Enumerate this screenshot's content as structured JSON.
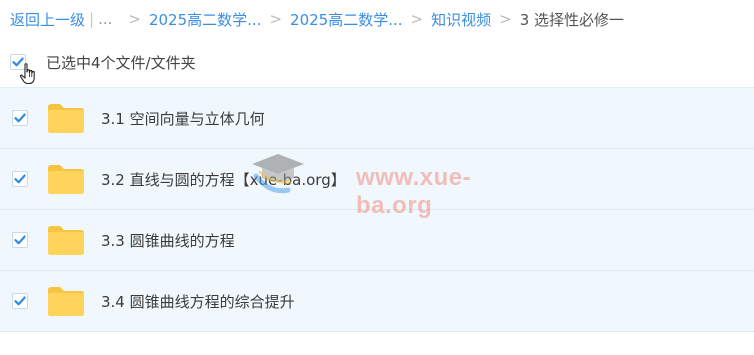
{
  "breadcrumb": {
    "back": "返回上一级",
    "divider": "|",
    "ellipsis": "...",
    "items": [
      "2025高二数学...",
      "2025高二数学...",
      "知识视频"
    ],
    "separator": ">",
    "current": "3 选择性必修一"
  },
  "selection": {
    "label": "已选中4个文件/文件夹",
    "checked": true
  },
  "files": [
    {
      "name": "3.1 空间向量与立体几何",
      "checked": true,
      "icon": "folder-icon"
    },
    {
      "name": "3.2 直线与圆的方程【xue-ba.org】",
      "checked": true,
      "icon": "folder-icon"
    },
    {
      "name": "3.3 圆锥曲线的方程",
      "checked": true,
      "icon": "folder-icon"
    },
    {
      "name": "3.4 圆锥曲线方程的综合提升",
      "checked": true,
      "icon": "folder-icon"
    }
  ],
  "watermark": {
    "text": "www.xue-ba.org"
  },
  "colors": {
    "link": "#3a8ee6",
    "check": "#2f8be0",
    "row_bg": "#f1f8fd",
    "folder": "#ffd45a",
    "watermark": "#f08c82"
  }
}
